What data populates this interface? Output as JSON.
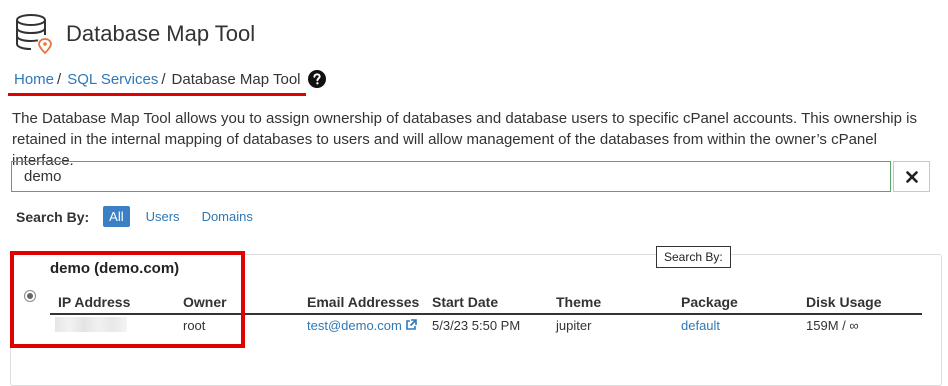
{
  "header": {
    "title": "Database Map Tool",
    "icon": "database-map-icon"
  },
  "breadcrumb": {
    "items": [
      {
        "label": "Home",
        "link": true
      },
      {
        "label": "SQL Services",
        "link": true
      },
      {
        "label": "Database Map Tool",
        "link": false
      }
    ],
    "separator": "/",
    "help_icon": "question-circle-icon"
  },
  "description": "The Database Map Tool allows you to assign ownership of databases and database users to specific cPanel accounts. This ownership is retained in the internal mapping of databases to users and will allow management of the databases from within the owner’s cPanel interface.",
  "search": {
    "value": "demo",
    "placeholder": "",
    "clear_icon": "close-icon"
  },
  "search_by": {
    "label": "Search By:",
    "options": [
      {
        "label": "All",
        "active": true
      },
      {
        "label": "Users",
        "active": false
      },
      {
        "label": "Domains",
        "active": false
      }
    ],
    "tooltip": "Search By:"
  },
  "account": {
    "title": "demo (demo.com)",
    "columns": [
      "IP Address",
      "Owner",
      "Email Addresses",
      "Start Date",
      "Theme",
      "Package",
      "Disk Usage"
    ],
    "row": {
      "ip": "",
      "owner": "root",
      "email": "test@demo.com",
      "start_date": "5/3/23 5:50 PM",
      "theme": "jupiter",
      "package": "default",
      "disk_usage": "159M / ∞"
    }
  },
  "colors": {
    "link": "#2f78b6",
    "accent": "#3b7fc4",
    "annotation": "#e00000",
    "search_border": "#5aa566"
  }
}
